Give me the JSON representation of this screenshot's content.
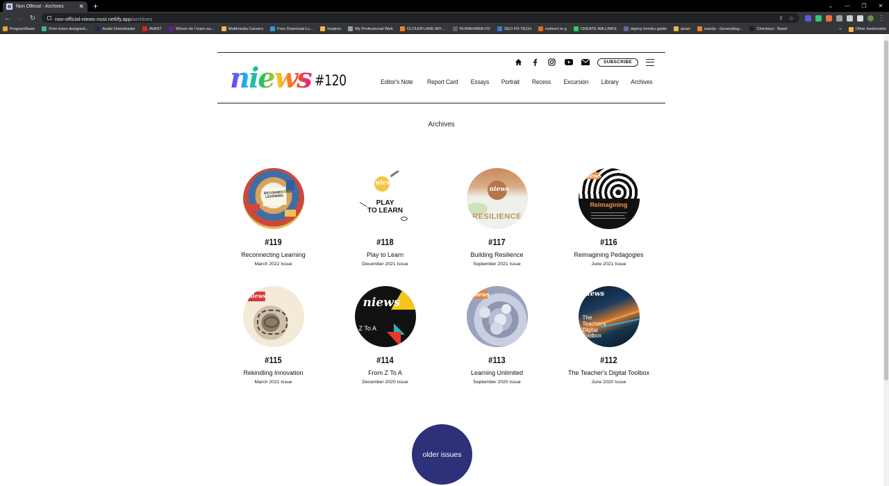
{
  "browser": {
    "tab_title": "Non Official - Archives",
    "url_host": "non-official-niews-nust.netlify.app",
    "url_path": "/archives",
    "bookmarks": [
      {
        "label": "ProgramBasic",
        "color": "#e8a33b"
      },
      {
        "label": "Free icons designed...",
        "color": "#41b883"
      },
      {
        "label": "Audio Downloader",
        "color": "#1c2b4a"
      },
      {
        "label": "AVAST",
        "color": "#e2231a"
      },
      {
        "label": "Where do I learn au...",
        "color": "#6a1b9a"
      },
      {
        "label": "Multimedia Careers",
        "color": "#f2b94b"
      },
      {
        "label": "Free Download Lu...",
        "color": "#2d9cdb"
      },
      {
        "label": "inspires",
        "color": "#f2b94b"
      },
      {
        "label": "My Professional Web",
        "color": "#9aa0a6"
      },
      {
        "label": "CLOUDFLARE-MY-...",
        "color": "#f48120"
      },
      {
        "label": "RUMAHWEB-FD",
        "color": "#5f6368"
      },
      {
        "label": "SEO FD-TECH",
        "color": "#3a7bd5"
      },
      {
        "label": "redirect to g",
        "color": "#e06b1f"
      },
      {
        "label": "CREATE WA LINKS",
        "color": "#25d366"
      },
      {
        "label": "deploy heroku guide",
        "color": "#6762a6"
      },
      {
        "label": "asset",
        "color": "#f2b94b"
      },
      {
        "label": "reactjs - Generating...",
        "color": "#f48024"
      },
      {
        "label": "Checkout - Basel",
        "color": "#202124"
      }
    ],
    "bookmarks_overflow": "»",
    "other_bookmarks": "Other bookmarks"
  },
  "header": {
    "issue_label": "#120",
    "subscribe_label": "SUBSCRIBE",
    "nav": [
      "Editor's Note",
      "Report Card",
      "Essays",
      "Portrait",
      "Recess",
      "Excursion",
      "Library",
      "Archives"
    ]
  },
  "page": {
    "heading": "Archives",
    "older_label": "older issues"
  },
  "issues": [
    {
      "number": "#119",
      "title": "Reconnecting Learning",
      "date": "March 2022 Issue"
    },
    {
      "number": "#118",
      "title": "Play to Learn",
      "date": "December 2021 Issue"
    },
    {
      "number": "#117",
      "title": "Building Resilience",
      "date": "September 2021 Issue"
    },
    {
      "number": "#116",
      "title": "Reimagining Pedagogies",
      "date": "June 2021 Issue"
    },
    {
      "number": "#115",
      "title": "Rekindling Innovation",
      "date": "March 2021 Issue"
    },
    {
      "number": "#114",
      "title": "From Z To A",
      "date": "December 2020 Issue"
    },
    {
      "number": "#113",
      "title": "Learning Unlimited",
      "date": "September 2020 Issue"
    },
    {
      "number": "#112",
      "title": "The Teacher's Digital Toolbox",
      "date": "June 2020 Issue"
    }
  ],
  "covers": {
    "c118": "PLAY\nTO LEARN",
    "c117": "RESILIENCE",
    "c116": "Reimagining",
    "c114": "Z To A",
    "c112": "The Teacher's Digital Toolbox"
  },
  "colors": {
    "older_button": "#2e3079",
    "text": "#111111"
  }
}
